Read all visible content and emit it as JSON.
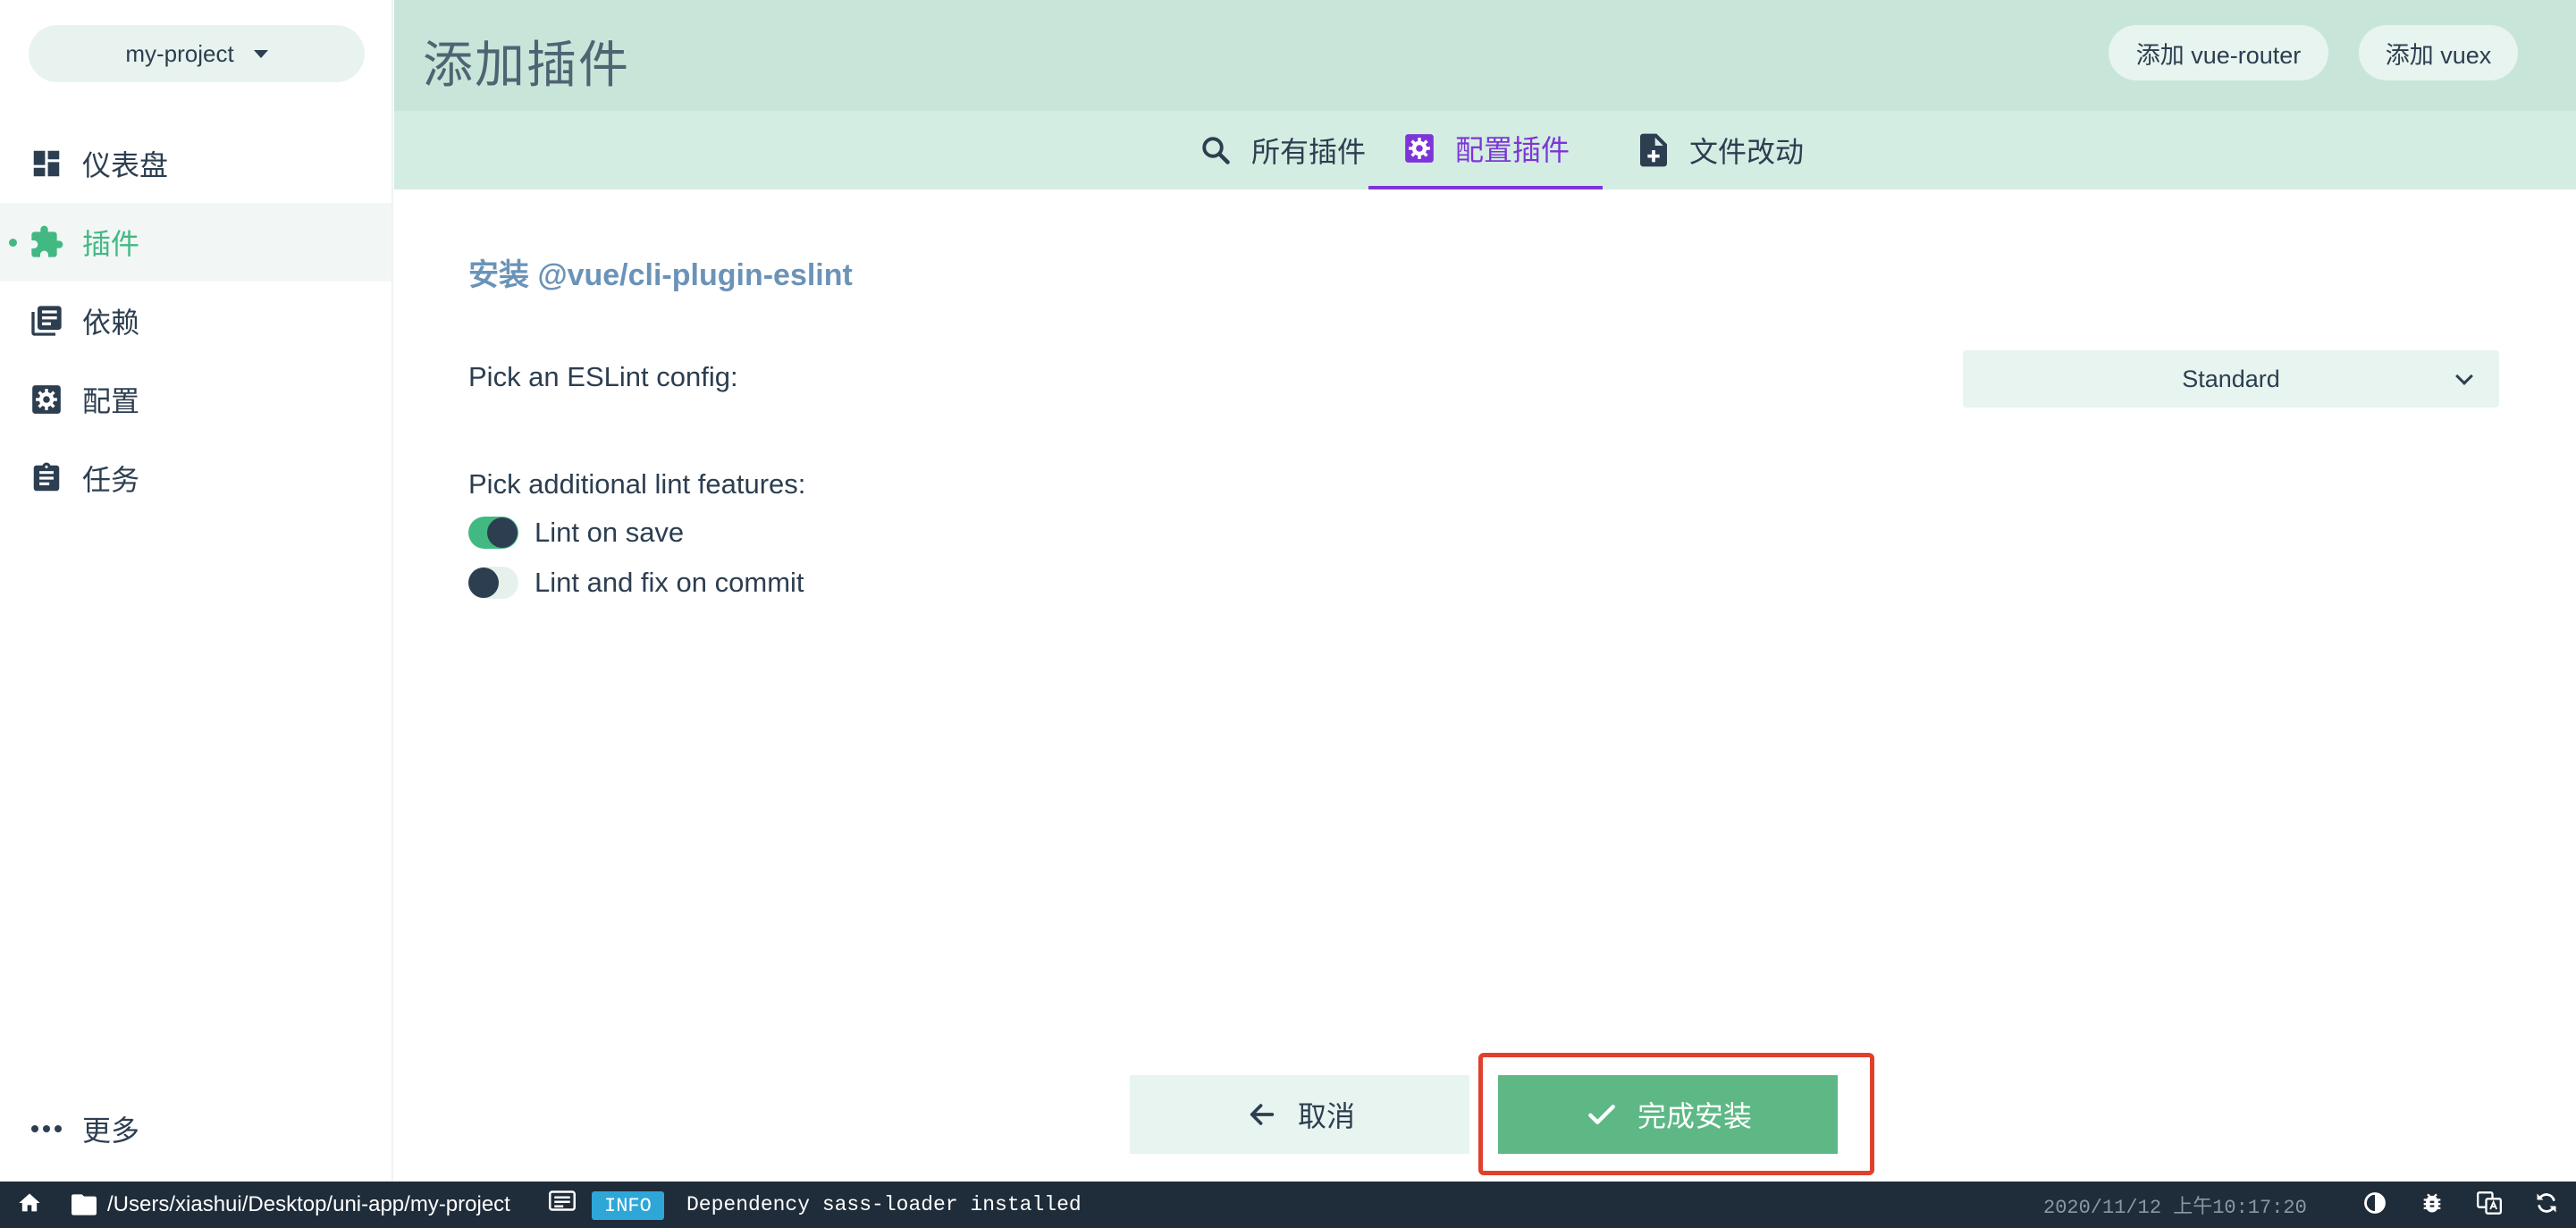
{
  "sidebar": {
    "project": "my-project",
    "items": [
      {
        "label": "仪表盘",
        "icon": "dashboard-icon"
      },
      {
        "label": "插件",
        "icon": "puzzle-icon"
      },
      {
        "label": "依赖",
        "icon": "library-books-icon"
      },
      {
        "label": "配置",
        "icon": "gear-icon"
      },
      {
        "label": "任务",
        "icon": "clipboard-icon"
      }
    ],
    "active_index": 1,
    "more_label": "更多"
  },
  "header": {
    "title": "添加插件",
    "buttons": {
      "router": "添加 vue-router",
      "vuex": "添加 vuex"
    }
  },
  "tabs": [
    {
      "label": "所有插件",
      "icon": "search-icon"
    },
    {
      "label": "配置插件",
      "icon": "gear-icon"
    },
    {
      "label": "文件改动",
      "icon": "file-plus-icon"
    }
  ],
  "active_tab": 1,
  "main": {
    "heading": "安装 @vue/cli-plugin-eslint",
    "eslint_label": "Pick an ESLint config:",
    "eslint_value": "Standard",
    "features_label": "Pick additional lint features:",
    "features": [
      {
        "label": "Lint on save",
        "checked": true
      },
      {
        "label": "Lint and fix on commit",
        "checked": false
      }
    ]
  },
  "footer": {
    "cancel_label": "取消",
    "finish_label": "完成安装"
  },
  "statusbar": {
    "path": "/Users/xiashui/Desktop/uni-app/my-project",
    "level": "INFO",
    "message": "Dependency sass-loader installed",
    "time": "2020/11/12 上午10:17:20"
  },
  "colors": {
    "accent": "#42b983",
    "tab_active": "#7e35d8",
    "header_bg": "#c7e6d9",
    "tabs_bg": "#d3ede2",
    "finish_button": "#5db886",
    "highlight": "#e0402c",
    "statusbar_bg": "#1f2c3a",
    "info_badge": "#2ea7d8"
  }
}
